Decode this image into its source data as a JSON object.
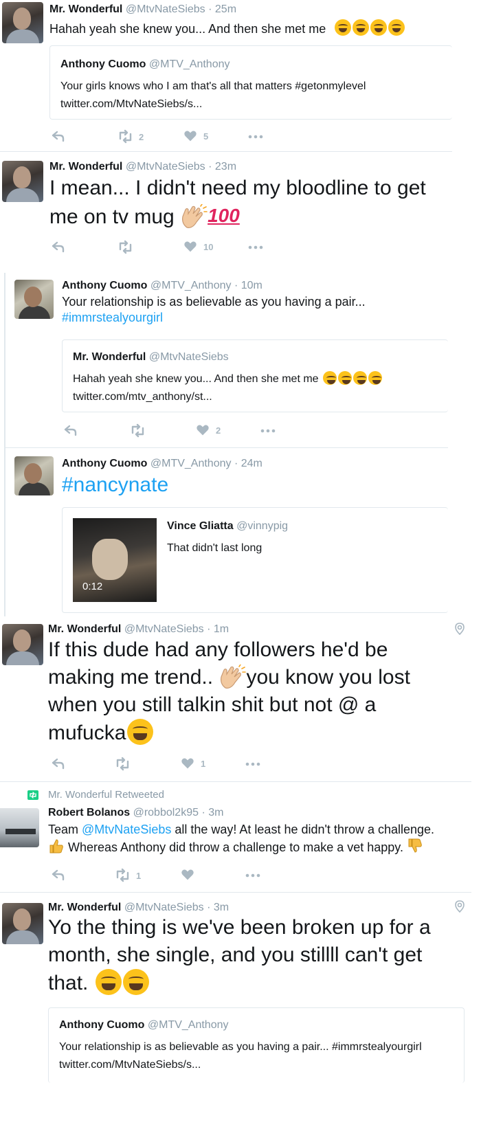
{
  "tweets": [
    {
      "name": "Mr. Wonderful",
      "handle": "@MtvNateSiebs",
      "time": "25m",
      "text": "Hahah yeah she knew you... And then she met me",
      "quote": {
        "name": "Anthony Cuomo",
        "handle": "@MTV_Anthony",
        "text1": "Your girls knows who I am that's all that matters #getonmylevel",
        "text2": "twitter.com/MtvNateSiebs/s..."
      },
      "retweets": "2",
      "likes": "5"
    },
    {
      "name": "Mr. Wonderful",
      "handle": "@MtvNateSiebs",
      "time": "23m",
      "line1": "I mean... I didn't need my bloodline to get",
      "line2": "me on tv mug",
      "retweets": "",
      "likes": "10"
    },
    {
      "name": "Anthony Cuomo",
      "handle": "@MTV_Anthony",
      "time": "10m",
      "text": "Your relationship is as believable as you having a pair...",
      "hashtag": "#immrstealyourgirl",
      "quote": {
        "name": "Mr. Wonderful",
        "handle": "@MtvNateSiebs",
        "text1": "Hahah yeah she knew you... And then she met me",
        "text2": "twitter.com/mtv_anthony/st..."
      },
      "retweets": "",
      "likes": "2"
    },
    {
      "name": "Anthony Cuomo",
      "handle": "@MTV_Anthony",
      "time": "24m",
      "hashtag": "#nancynate",
      "quote": {
        "name": "Vince Gliatta",
        "handle": "@vinnypig",
        "text1": "That didn't last long",
        "video_time": "0:12"
      }
    },
    {
      "name": "Mr. Wonderful",
      "handle": "@MtvNateSiebs",
      "time": "1m",
      "line1": "If this dude had any followers he'd be",
      "line2": "making me trend..",
      "line2b": "you know you lost",
      "line3": "when you still talkin shit but not @ a",
      "line4": "mufucka",
      "retweets": "",
      "likes": "1"
    },
    {
      "retweeted_label": "Mr. Wonderful Retweeted",
      "name": "Robert Bolanos",
      "handle": "@robbol2k95",
      "time": "3m",
      "text_a": "Team ",
      "mention": "@MtvNateSiebs",
      "text_b": " all the way! At least he didn't throw a challenge.",
      "text_c": " Whereas Anthony did throw a challenge to make a vet happy.",
      "retweets": "1",
      "likes": ""
    },
    {
      "name": "Mr. Wonderful",
      "handle": "@MtvNateSiebs",
      "time": "3m",
      "line1": "Yo the thing is we've been broken up for a",
      "line2": "month, she single, and you stillll can't get",
      "line3": "that.",
      "quote": {
        "name": "Anthony Cuomo",
        "handle": "@MTV_Anthony",
        "text1": "Your relationship is as believable as you having a pair... #immrstealyourgirl",
        "text2": "twitter.com/MtvNateSiebs/s..."
      }
    }
  ],
  "sep": "·",
  "colors": {
    "link": "#1da1f2",
    "muted": "#8899a6",
    "icon": "#aab8c2",
    "retweet_green": "#19cf86"
  }
}
